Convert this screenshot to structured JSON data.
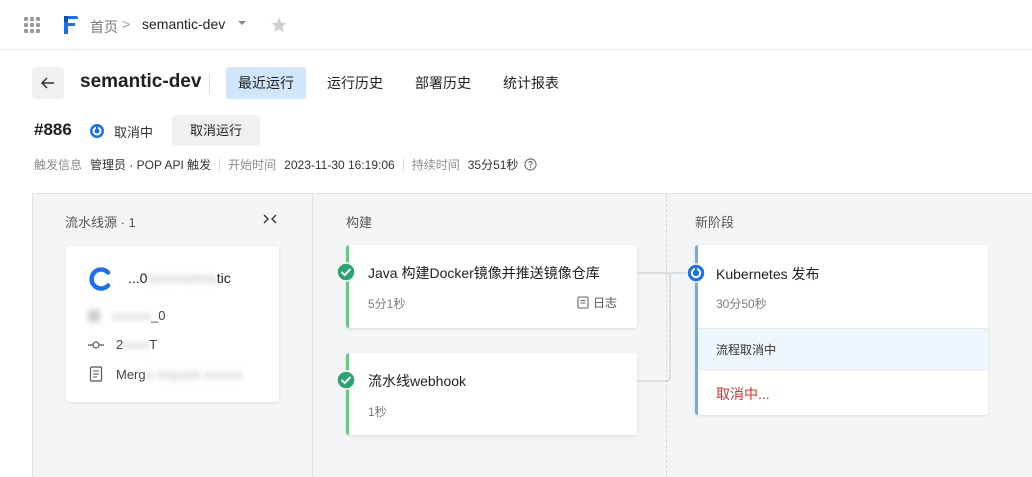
{
  "nav": {
    "breadcrumb_home": "首页",
    "breadcrumb_sep": ">",
    "breadcrumb_current": "semantic-dev"
  },
  "header": {
    "title": "semantic-dev",
    "tabs": [
      {
        "label": "最近运行",
        "active": true
      },
      {
        "label": "运行历史",
        "active": false
      },
      {
        "label": "部署历史",
        "active": false
      },
      {
        "label": "统计报表",
        "active": false
      }
    ]
  },
  "run": {
    "id": "#886",
    "status": "取消中",
    "cancel_button": "取消运行",
    "trigger_label": "触发信息",
    "trigger_value": "管理员 · POP API 触发",
    "start_label": "开始时间",
    "start_value": "2023-11-30 16:19:06",
    "duration_label": "持续时间",
    "duration_value": "35分51秒"
  },
  "stages": {
    "source": {
      "title": "流水线源 · 1",
      "card": {
        "name": "...0",
        "name_tail": "tic",
        "branch": "_0",
        "commit": "2",
        "commit_tail": "T",
        "message": "Merg"
      }
    },
    "build": {
      "title": "构建",
      "jobs": [
        {
          "name": "Java 构建Docker镜像并推送镜像仓库",
          "duration": "5分1秒",
          "log": "日志",
          "status": "success"
        },
        {
          "name": "流水线webhook",
          "duration": "1秒",
          "status": "success"
        }
      ]
    },
    "deploy": {
      "title": "新阶段",
      "job": {
        "name": "Kubernetes 发布",
        "duration": "30分50秒",
        "substatus": "流程取消中",
        "action": "取消中..."
      }
    }
  },
  "colors": {
    "accent": "#1b6ff2",
    "tab_active_bg": "#cfe6fb",
    "success": "#2ba471",
    "cancel_red": "#d93026"
  }
}
